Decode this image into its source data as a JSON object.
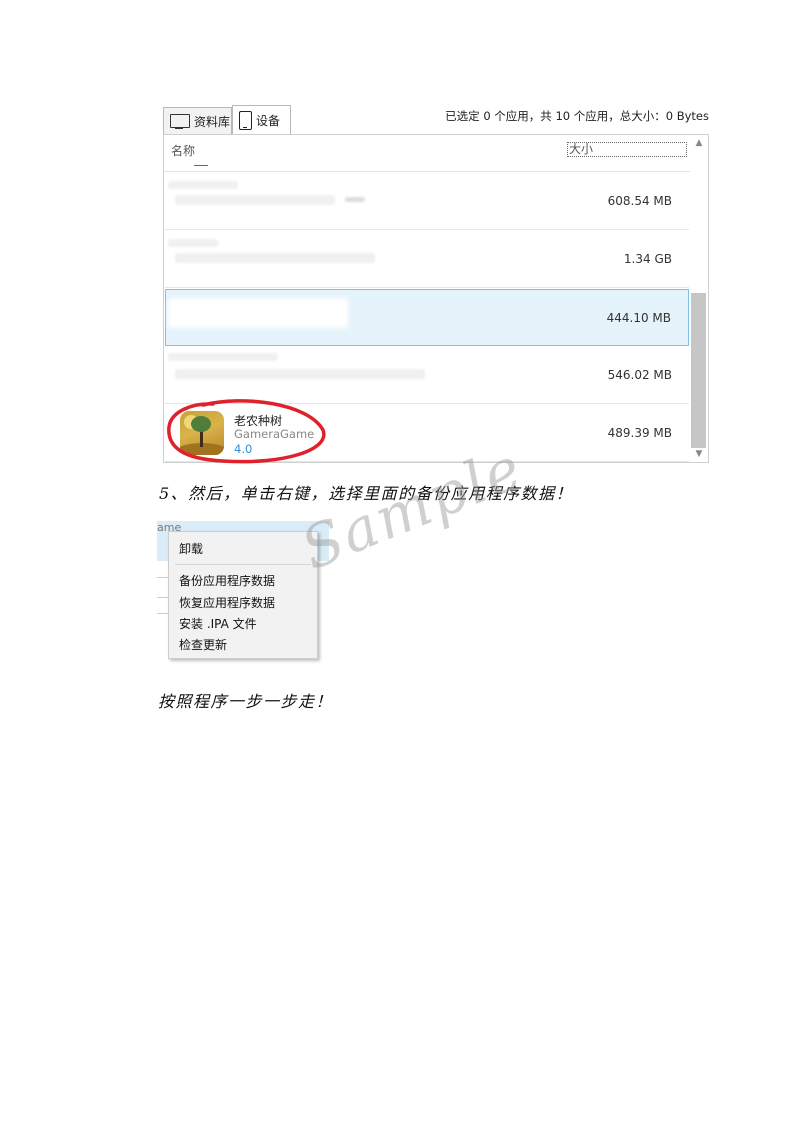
{
  "panel": {
    "tabs": [
      {
        "label": "资料库",
        "icon": "monitor-icon"
      },
      {
        "label": "设备",
        "icon": "phone-icon"
      }
    ],
    "summary": "已选定 0 个应用，共 10 个应用，总大小：0 Bytes",
    "columns": {
      "name": "名称",
      "size": "大小"
    },
    "rows": [
      {
        "size": "608.54 MB",
        "selected": false
      },
      {
        "size": "1.34 GB",
        "selected": false
      },
      {
        "size": "444.10 MB",
        "selected": true
      },
      {
        "size": "546.02 MB",
        "selected": false
      },
      {
        "name": "老农种树",
        "developer": "GameraGame",
        "version": "4.0",
        "size": "489.39 MB",
        "selected": false
      }
    ]
  },
  "step_text": "5、然后，单击右键，选择里面的备份应用程序数据！",
  "context_menu": {
    "background_text": "ame",
    "items": [
      "卸载",
      "备份应用程序数据",
      "恢复应用程序数据",
      "安装 .IPA 文件",
      "检查更新"
    ]
  },
  "watermark": "Sample",
  "final_text": "按照程序一步一步走！",
  "colors": {
    "selected_row": "#e5f3fb",
    "selected_border": "#7ec1e8",
    "annotation": "#e0202a",
    "version": "#2f8fdc"
  }
}
